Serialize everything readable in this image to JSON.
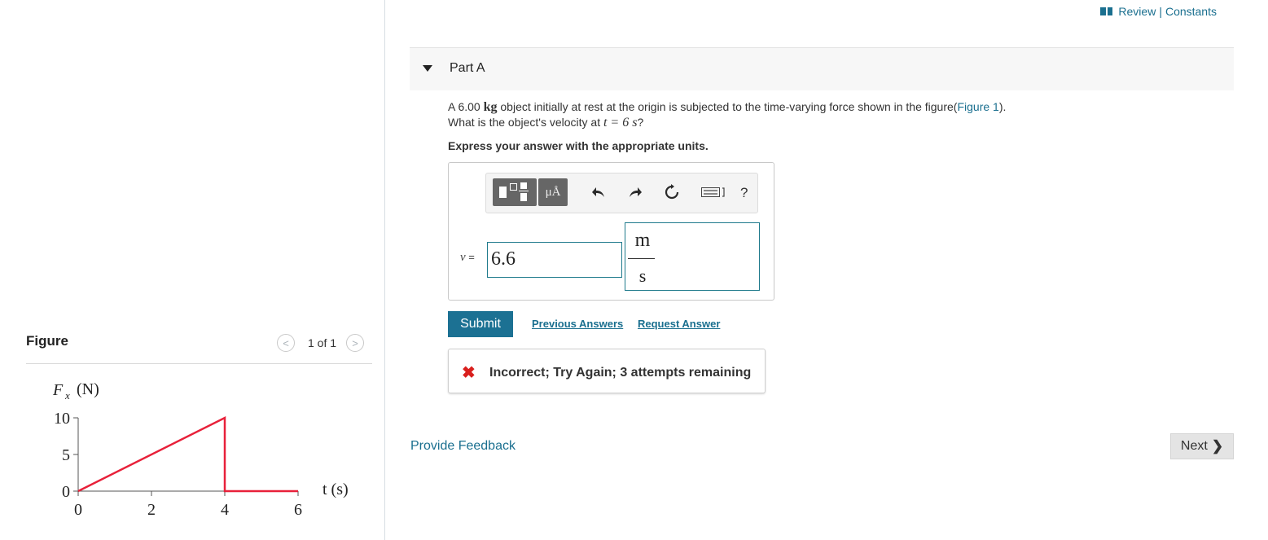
{
  "header": {
    "review_label": "Review",
    "separator": "|",
    "constants_label": "Constants"
  },
  "part": {
    "title": "Part A"
  },
  "question": {
    "text_1": "A 6.00 ",
    "math_kg": "kg",
    "text_2": " object initially at rest at the origin is subjected to the time-varying force shown in the figure(",
    "figure_link": "Figure 1",
    "text_3": ").",
    "line2_text": "What is the object's velocity at ",
    "line2_math": "t = 6 s",
    "line2_end": "?"
  },
  "instructions": "Express your answer with the appropriate units.",
  "answer": {
    "variable": "v",
    "equals": "=",
    "value": "6.6",
    "unit_numerator": "m",
    "unit_denominator": "s"
  },
  "toolbar": {
    "mu_label": "μÅ",
    "help_label": "?"
  },
  "actions": {
    "submit_label": "Submit",
    "previous_answers_label": "Previous Answers",
    "request_answer_label": "Request Answer"
  },
  "feedback": {
    "icon": "✖",
    "message": "Incorrect; Try Again; 3 attempts remaining"
  },
  "provide_feedback_label": "Provide Feedback",
  "next_label": "Next",
  "figure": {
    "title": "Figure",
    "pager_prev": "<",
    "pager_next": ">",
    "pager_text": "1 of 1"
  },
  "chart_data": {
    "type": "line",
    "ylabel_symbol": "F",
    "ylabel_subscript": "x",
    "ylabel_unit": "(N)",
    "xlabel": "t (s)",
    "x_ticks": [
      "0",
      "2",
      "4",
      "6"
    ],
    "y_ticks": [
      "0",
      "5",
      "10"
    ],
    "xlim": [
      0,
      6
    ],
    "ylim": [
      0,
      10
    ],
    "series": [
      {
        "points": [
          [
            0,
            0
          ],
          [
            4,
            10
          ],
          [
            4,
            0
          ],
          [
            6,
            0
          ]
        ]
      }
    ],
    "line_color": "#e8213a"
  },
  "colors": {
    "link": "#1a6f8f",
    "submit_bg": "#1c7193",
    "error_x": "#d9201e",
    "input_border": "#1f7a8c"
  }
}
